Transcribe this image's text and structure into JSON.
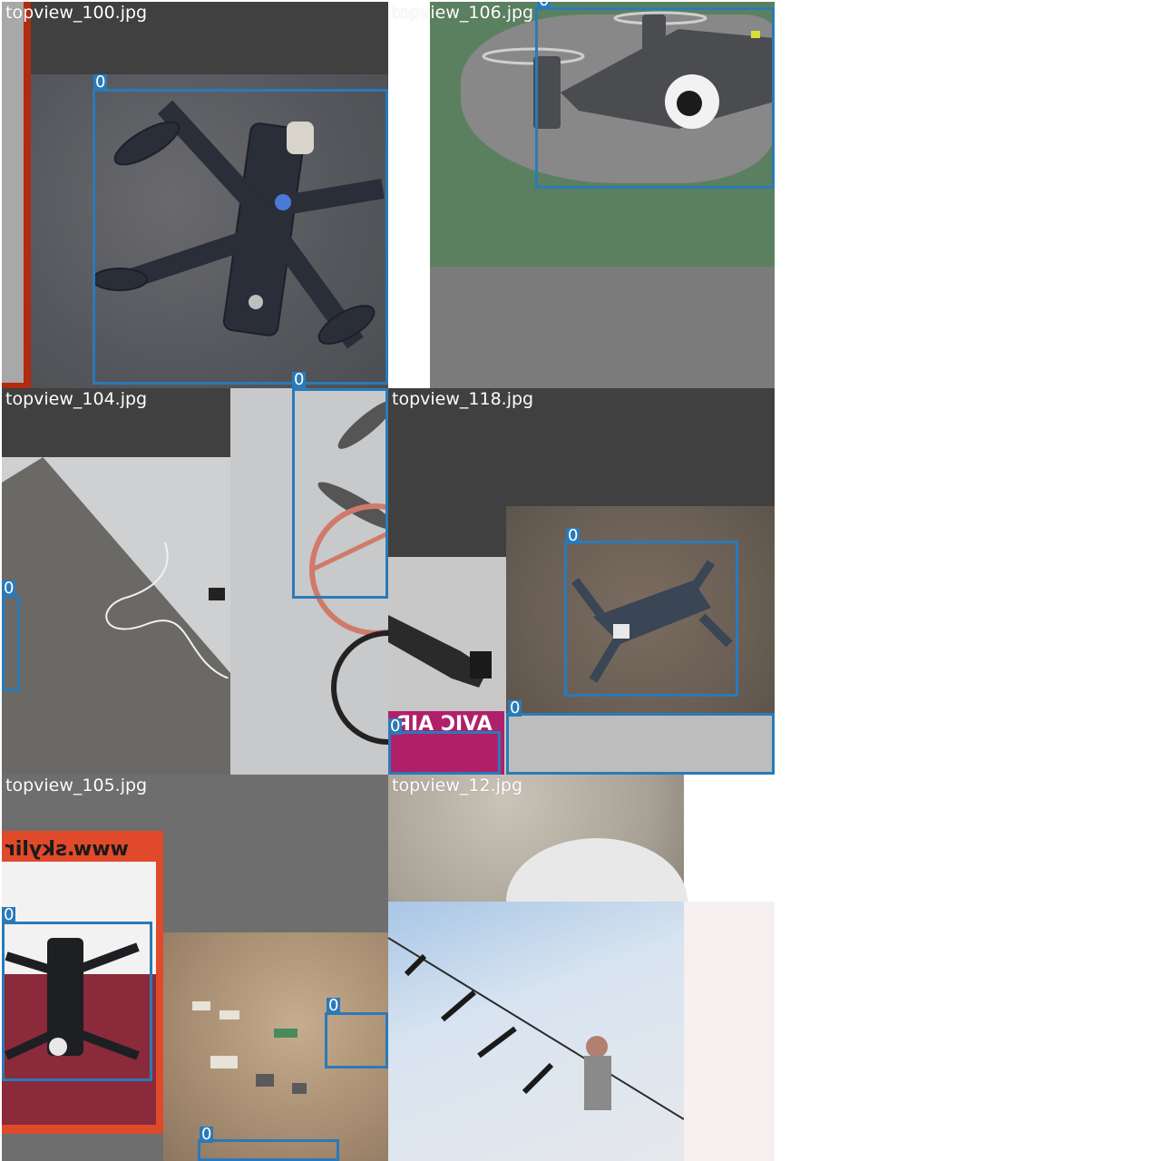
{
  "mosaic": {
    "tiles": [
      {
        "id": "t1",
        "filename": "topview_100.jpg",
        "labels": [
          "0",
          "0"
        ]
      },
      {
        "id": "t2",
        "filename": "topview_106.jpg",
        "labels": [
          "0"
        ]
      },
      {
        "id": "t3",
        "filename": "topview_104.jpg",
        "labels": [
          "0"
        ]
      },
      {
        "id": "t4",
        "filename": "topview_118.jpg",
        "labels": [
          "0",
          "0",
          "0"
        ],
        "sign_text": "AVIC AIR"
      },
      {
        "id": "t5",
        "filename": "topview_105.jpg",
        "labels": [
          "0",
          "0",
          "0"
        ],
        "sign_text": "www.skylir"
      },
      {
        "id": "t6",
        "filename": "topview_12.jpg",
        "labels": []
      }
    ]
  },
  "colors": {
    "bbox": "#2a7ab8",
    "label_text": "#ffffff",
    "dark_band": "#404040",
    "mid_band": "#6e6e6e",
    "green_bg": "#5b8060"
  }
}
